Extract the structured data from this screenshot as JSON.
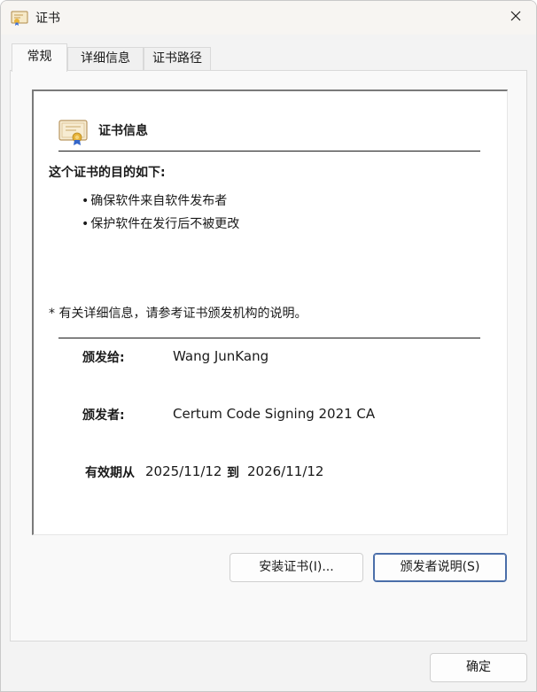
{
  "window": {
    "title": "证书"
  },
  "tabs": [
    {
      "label": "常规",
      "active": true
    },
    {
      "label": "详细信息",
      "active": false
    },
    {
      "label": "证书路径",
      "active": false
    }
  ],
  "general": {
    "header": "证书信息",
    "purpose_title": "这个证书的目的如下:",
    "purposes": [
      "确保软件来自软件发布者",
      "保护软件在发行后不被更改"
    ],
    "note": "* 有关详细信息，请参考证书颁发机构的说明。",
    "issued_to_label": "颁发给:",
    "issued_to": "Wang JunKang",
    "issued_by_label": "颁发者:",
    "issued_by": "Certum Code Signing 2021 CA",
    "valid_label": "有效期从",
    "valid_from": "2025/11/12",
    "valid_to_label": "到",
    "valid_to": "2026/11/12"
  },
  "buttons": {
    "install": "安装证书(I)...",
    "issuer_statement": "颁发者说明(S)",
    "ok": "确定"
  },
  "icons": {
    "title": "certificate-icon",
    "close": "close-icon",
    "cert_info": "certificate-icon"
  },
  "colors": {
    "accent_border": "#4a6ea9",
    "window_bg": "#f3f3f3"
  }
}
